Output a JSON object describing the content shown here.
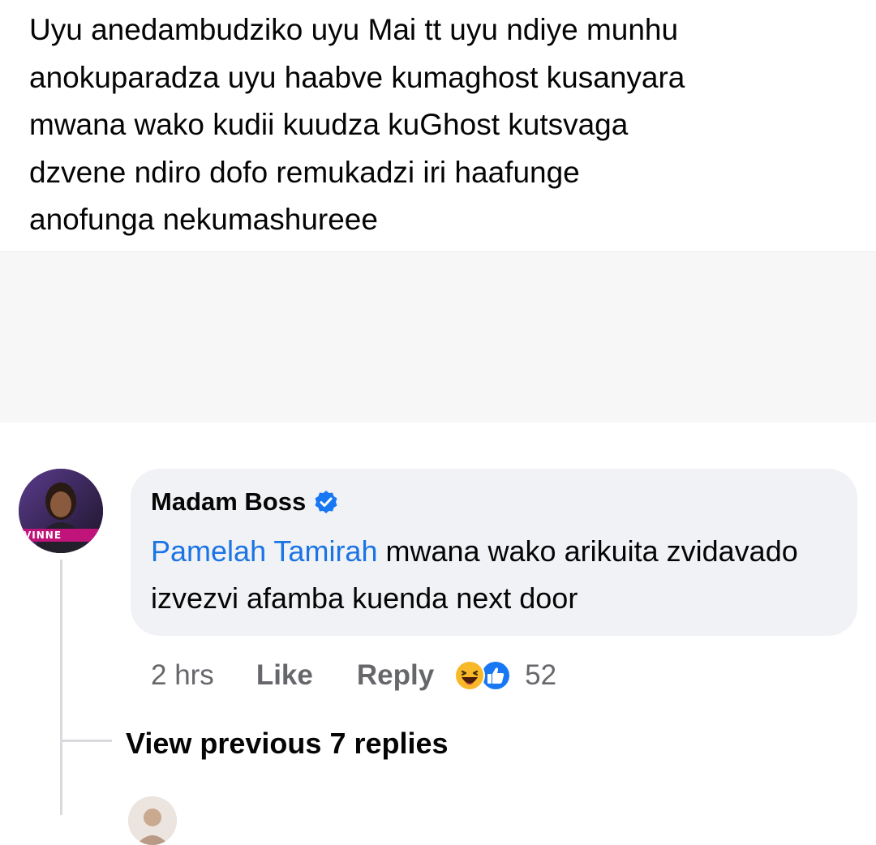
{
  "post": {
    "text": "Uyu anedambudziko uyu Mai tt uyu ndiye munhu\nanokuparadza uyu haabve kumaghost kusanyara\nmwana wako kudii kuudza kuGhost kutsvaga\ndzvene ndiro dofo remukadzi iri haafunge\nanofunga nekumashureee"
  },
  "comment": {
    "author": "Madam Boss",
    "avatar_badge": "VINNE",
    "mention": "Pamelah Tamirah",
    "body": " mwana wako arikuita zvidavado izvezvi afamba kuenda next door",
    "time": "2 hrs",
    "like_label": "Like",
    "reply_label": "Reply",
    "reaction_icons": [
      "haha-reaction-icon",
      "like-reaction-icon"
    ],
    "reaction_count": "52"
  },
  "thread": {
    "view_previous_label": "View previous 7 replies"
  },
  "colors": {
    "mention": "#1b74e4",
    "bubble": "#f0f2f5",
    "verified": "#1877f2",
    "secondary_text": "#65676b",
    "haha": "#f7b928",
    "like": "#1877f2"
  }
}
